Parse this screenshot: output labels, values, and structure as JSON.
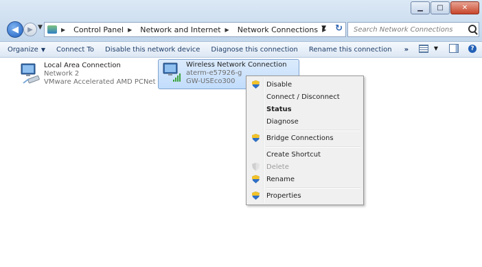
{
  "window": {
    "minimize_icon": "minimize-icon",
    "maximize_icon": "maximize-icon",
    "close_icon": "close-icon"
  },
  "address": {
    "breadcrumbs": [
      "Control Panel",
      "Network and Internet",
      "Network Connections"
    ],
    "search_placeholder": "Search Network Connections"
  },
  "commands": {
    "organize": "Organize",
    "connect_to": "Connect To",
    "disable_device": "Disable this network device",
    "diagnose": "Diagnose this connection",
    "rename": "Rename this connection",
    "more": "»"
  },
  "connections": [
    {
      "name": "Local Area Connection",
      "network": "Network  2",
      "device": "VMware Accelerated AMD PCNet ..."
    },
    {
      "name": "Wireless Network Connection",
      "network": "aterm-e57926-g",
      "device": "GW-USEco300"
    }
  ],
  "context_menu": {
    "items": [
      {
        "label": "Disable",
        "icon": "shield-icon",
        "style": "normal"
      },
      {
        "label": "Connect / Disconnect",
        "icon": "",
        "style": "normal"
      },
      {
        "label": "Status",
        "icon": "",
        "style": "bold"
      },
      {
        "label": "Diagnose",
        "icon": "",
        "style": "normal"
      },
      {
        "label": "Bridge Connections",
        "icon": "shield-icon",
        "style": "normal"
      },
      {
        "label": "Create Shortcut",
        "icon": "",
        "style": "normal"
      },
      {
        "label": "Delete",
        "icon": "shield-icon",
        "style": "disabled"
      },
      {
        "label": "Rename",
        "icon": "shield-icon",
        "style": "normal"
      },
      {
        "label": "Properties",
        "icon": "shield-icon",
        "style": "normal"
      }
    ]
  },
  "colors": {
    "selection": "#c1dcfc",
    "command_text": "#1e3c68",
    "accent": "#2360b6"
  }
}
